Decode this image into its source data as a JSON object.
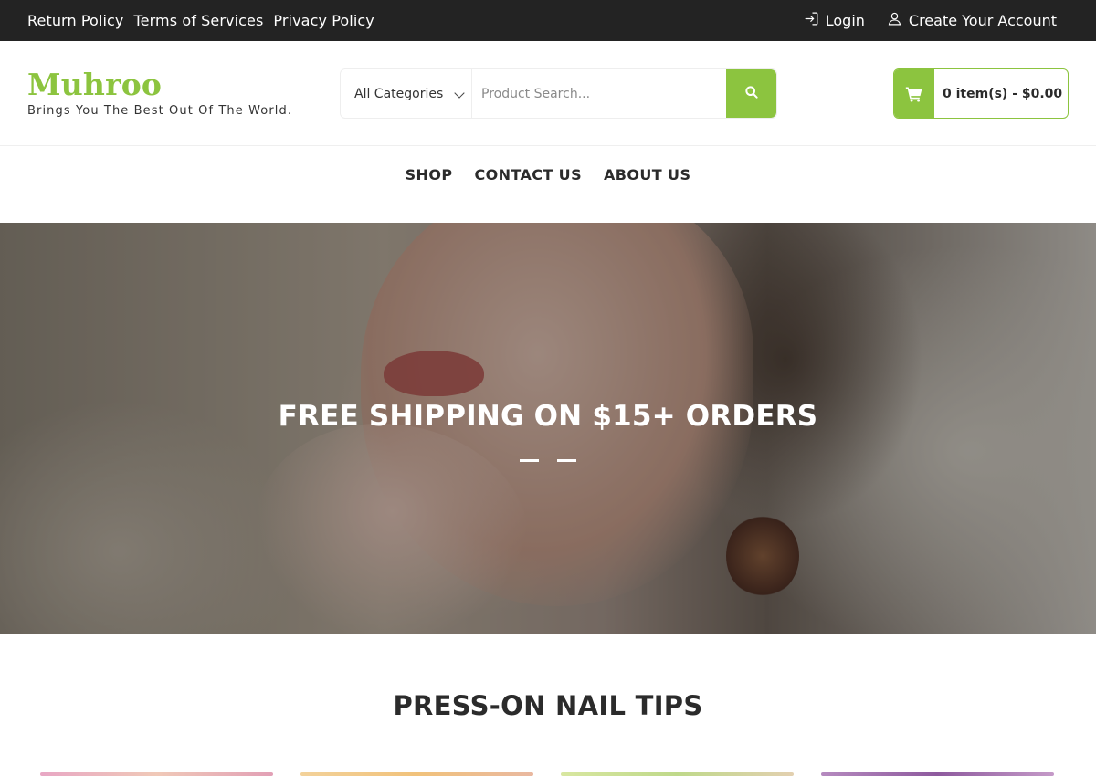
{
  "topbar": {
    "links": [
      "Return Policy",
      "Terms of Services",
      "Privacy Policy"
    ],
    "login_label": "Login",
    "create_account_label": "Create Your Account",
    "login_icon": "login-icon",
    "user_icon": "user-icon"
  },
  "header": {
    "logo": "Muhroo",
    "tagline": "Brings You The Best Out Of The World.",
    "search": {
      "category": "All Categories",
      "placeholder": "Product Search...",
      "button_icon": "search-icon"
    },
    "cart": {
      "icon": "cart-icon",
      "summary": "0 item(s) - $0.00"
    }
  },
  "nav": {
    "items": [
      "SHOP",
      "CONTACT US",
      "ABOUT US"
    ]
  },
  "hero": {
    "headline": "FREE SHIPPING ON $15+ ORDERS",
    "slide_count": 2
  },
  "section": {
    "title": "PRESS-ON NAIL TIPS"
  },
  "colors": {
    "accent": "#8cc43f",
    "topbar_bg": "#232323",
    "text": "#2b2b2b"
  }
}
